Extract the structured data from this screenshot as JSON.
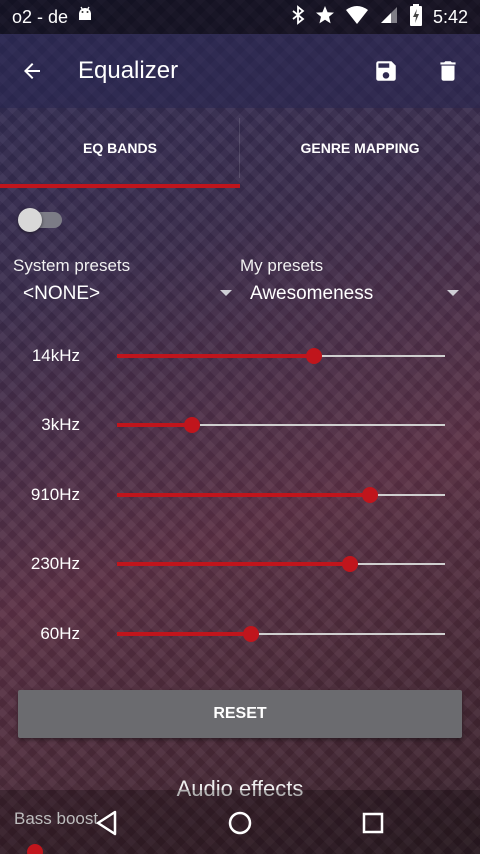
{
  "status_bar": {
    "carrier": "o2 - de",
    "time": "5:42",
    "icons": [
      "android-icon",
      "bluetooth-icon",
      "star-icon",
      "wifi-icon",
      "signal-icon",
      "battery-icon"
    ]
  },
  "app_bar": {
    "title": "Equalizer",
    "back_icon": "back-arrow-icon",
    "save_icon": "save-icon",
    "delete_icon": "delete-icon"
  },
  "tabs": [
    {
      "label": "EQ BANDS",
      "active": true
    },
    {
      "label": "GENRE MAPPING",
      "active": false
    }
  ],
  "equalizer": {
    "enabled": false,
    "system_presets": {
      "label": "System presets",
      "value": "<NONE>"
    },
    "my_presets": {
      "label": "My presets",
      "value": "Awesomeness"
    },
    "bands": [
      {
        "label": "14kHz",
        "level": 0.6
      },
      {
        "label": "3kHz",
        "level": 0.23
      },
      {
        "label": "910Hz",
        "level": 0.77
      },
      {
        "label": "230Hz",
        "level": 0.71
      },
      {
        "label": "60Hz",
        "level": 0.41
      }
    ],
    "reset_label": "RESET"
  },
  "audio_effects": {
    "title": "Audio effects",
    "bass_boost_label": "Bass boost"
  },
  "nav_bar": {
    "icons": [
      "nav-back-icon",
      "nav-home-icon",
      "nav-recents-icon"
    ]
  },
  "colors": {
    "accent": "#c0151c",
    "button_bg": "#6b6b6f",
    "slider_track": "#cfcfcf"
  }
}
